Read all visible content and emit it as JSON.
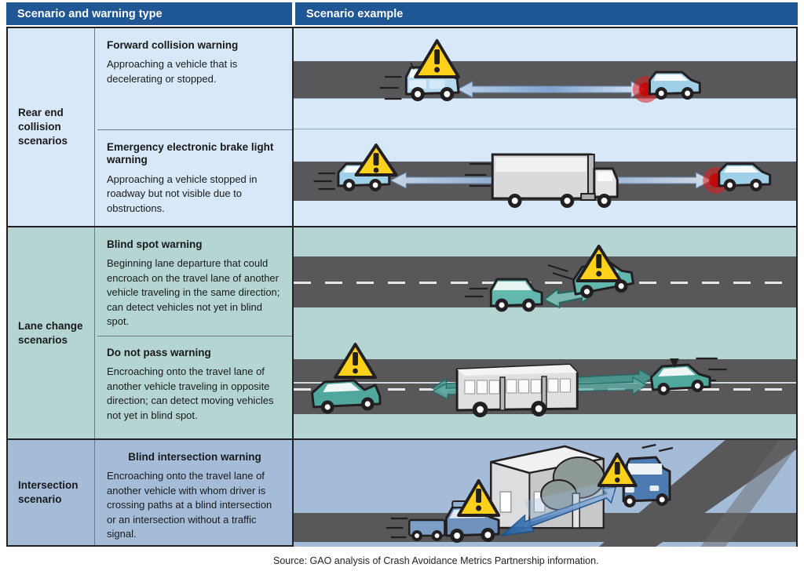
{
  "header": {
    "col1": "Scenario and warning type",
    "col2": "Scenario example"
  },
  "sections": [
    {
      "group_label": "Rear end collision scenarios",
      "accent": "#d7e8f8",
      "rows": [
        {
          "title": "Forward collision warning",
          "description": "Approaching a vehicle that is decelerating or stopped.",
          "illustration": "two-lane-road-following-vehicle-braking-ahead"
        },
        {
          "title": "Emergency electronic brake light warning",
          "description": "Approaching a vehicle stopped in roadway but not visible due to obstructions.",
          "illustration": "truck-obstructing-view-of-stopped-car"
        }
      ]
    },
    {
      "group_label": "Lane change scenarios",
      "accent": "#b4d5d1",
      "rows": [
        {
          "title": "Blind spot warning",
          "description": "Beginning lane departure that could encroach on the travel lane of another vehicle traveling in the same direction; can detect vehicles not yet in blind spot.",
          "illustration": "vehicle-merging-into-adjacent-lane-blind-spot"
        },
        {
          "title": "Do not pass warning",
          "description": "Encroaching onto the travel lane of another vehicle traveling in opposite direction; can detect moving vehicles not yet in blind spot.",
          "illustration": "car-passing-bus-into-oncoming-lane"
        }
      ]
    },
    {
      "group_label": "Intersection scenario",
      "accent": "#a4bcd8",
      "rows": [
        {
          "title": "Blind intersection warning",
          "description": "Encroaching onto the travel lane of another vehicle with whom driver is crossing paths at a blind intersection or an intersection without a traffic signal.",
          "illustration": "blind-intersection-building-obstructing-view"
        }
      ]
    }
  ],
  "icons": {
    "warning_triangle": "warning-triangle-icon",
    "warning_fill": "#ffd11a",
    "warning_stroke": "#231f20"
  },
  "source_note": "Source: GAO analysis of Crash Avoidance Metrics Partnership information."
}
